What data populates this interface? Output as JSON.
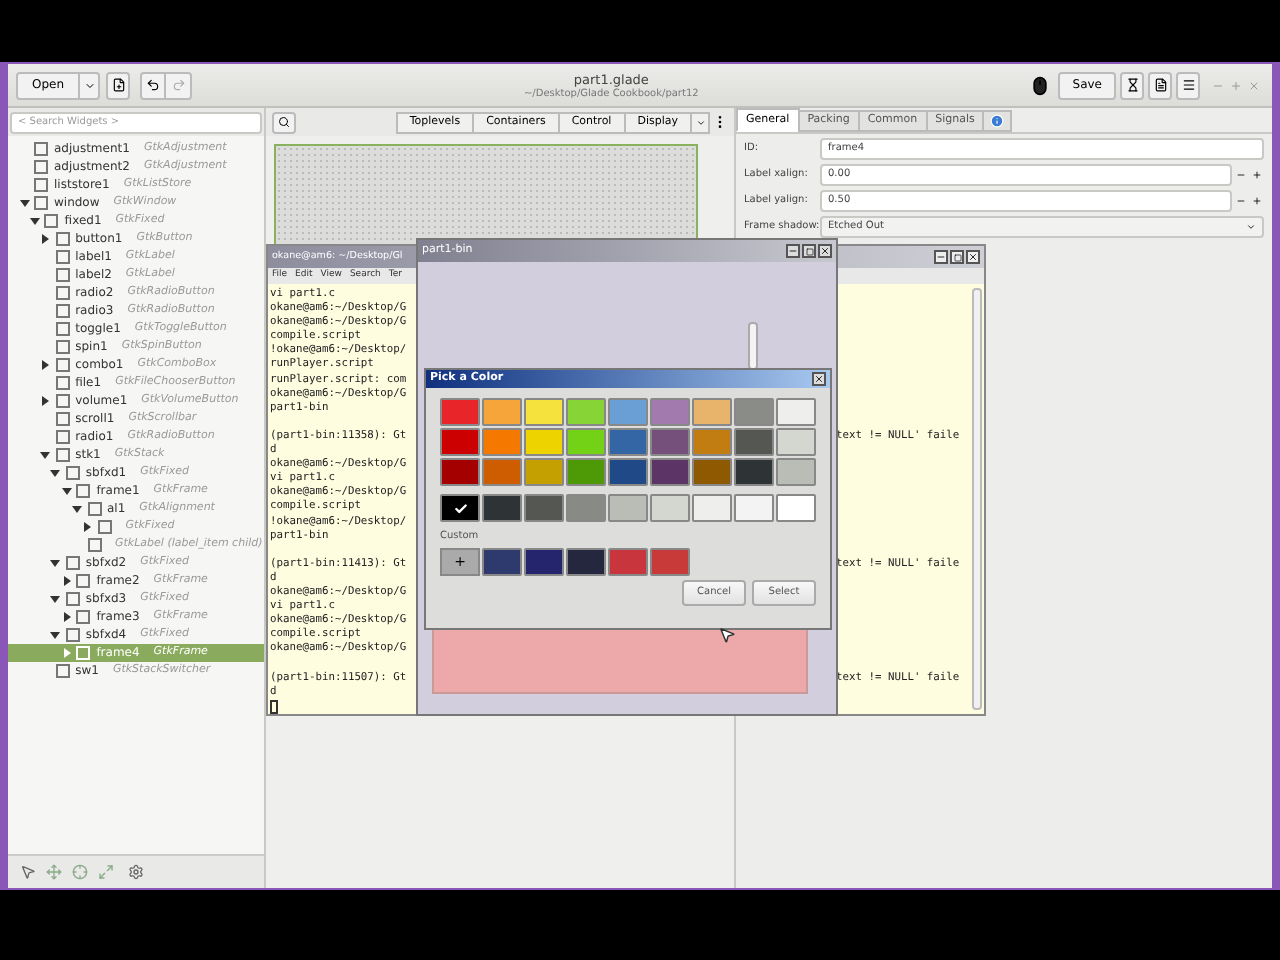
{
  "header": {
    "open_button": "Open",
    "title": "part1.glade",
    "subtitle": "~/Desktop/Glade Cookbook/part12",
    "save_button": "Save"
  },
  "search": {
    "placeholder": "< Search Widgets >"
  },
  "palette_tabs": [
    "Toplevels",
    "Containers",
    "Control",
    "Display"
  ],
  "tree": [
    {
      "name": "adjustment1",
      "type": "GtkAdjustment",
      "selected": false
    },
    {
      "name": "adjustment2",
      "type": "GtkAdjustment",
      "selected": false
    },
    {
      "name": "liststore1",
      "type": "GtkListStore",
      "selected": false
    },
    {
      "name": "window",
      "type": "GtkWindow",
      "selected": false,
      "expanded": true,
      "children": [
        {
          "name": "fixed1",
          "type": "GtkFixed",
          "selected": false,
          "expanded": true,
          "children": [
            {
              "name": "button1",
              "type": "GtkButton",
              "selected": false,
              "expanded": false
            },
            {
              "name": "label1",
              "type": "GtkLabel",
              "selected": false
            },
            {
              "name": "label2",
              "type": "GtkLabel",
              "selected": false
            },
            {
              "name": "radio2",
              "type": "GtkRadioButton",
              "selected": false
            },
            {
              "name": "radio3",
              "type": "GtkRadioButton",
              "selected": false
            },
            {
              "name": "toggle1",
              "type": "GtkToggleButton",
              "selected": false
            },
            {
              "name": "spin1",
              "type": "GtkSpinButton",
              "selected": false
            },
            {
              "name": "combo1",
              "type": "GtkComboBox",
              "selected": false,
              "expanded": false
            },
            {
              "name": "file1",
              "type": "GtkFileChooserButton",
              "selected": false
            },
            {
              "name": "volume1",
              "type": "GtkVolumeButton",
              "selected": false,
              "expanded": false
            },
            {
              "name": "scroll1",
              "type": "GtkScrollbar",
              "selected": false
            },
            {
              "name": "radio1",
              "type": "GtkRadioButton",
              "selected": false
            },
            {
              "name": "stk1",
              "type": "GtkStack",
              "selected": false,
              "expanded": true,
              "children": [
                {
                  "name": "sbfxd1",
                  "type": "GtkFixed",
                  "selected": false,
                  "expanded": true,
                  "children": [
                    {
                      "name": "frame1",
                      "type": "GtkFrame",
                      "selected": false,
                      "expanded": true,
                      "children": [
                        {
                          "name": "al1",
                          "type": "GtkAlignment",
                          "selected": false,
                          "expanded": true,
                          "children": [
                            {
                              "type": "GtkFixed",
                              "selected": false,
                              "expanded": false
                            }
                          ]
                        },
                        {
                          "type": "GtkLabel (label_item child)",
                          "selected": false
                        }
                      ]
                    }
                  ]
                },
                {
                  "name": "sbfxd2",
                  "type": "GtkFixed",
                  "selected": false,
                  "expanded": true,
                  "children": [
                    {
                      "name": "frame2",
                      "type": "GtkFrame",
                      "selected": false,
                      "expanded": false
                    }
                  ]
                },
                {
                  "name": "sbfxd3",
                  "type": "GtkFixed",
                  "selected": false,
                  "expanded": true,
                  "children": [
                    {
                      "name": "frame3",
                      "type": "GtkFrame",
                      "selected": false,
                      "expanded": false
                    }
                  ]
                },
                {
                  "name": "sbfxd4",
                  "type": "GtkFixed",
                  "selected": false,
                  "expanded": true,
                  "children": [
                    {
                      "name": "frame4",
                      "type": "GtkFrame",
                      "selected": true,
                      "expanded": false
                    }
                  ]
                }
              ]
            },
            {
              "name": "sw1",
              "type": "GtkStackSwitcher",
              "selected": false
            }
          ]
        }
      ]
    }
  ],
  "property_tabs": [
    {
      "label": "General",
      "selected": true
    },
    {
      "label": "Packing",
      "selected": false
    },
    {
      "label": "Common",
      "selected": false
    },
    {
      "label": "Signals",
      "selected": false
    }
  ],
  "properties": [
    {
      "label": "ID:",
      "value": "frame4",
      "kind": "text"
    },
    {
      "label": "Label xalign:",
      "value": "0.00",
      "kind": "spin"
    },
    {
      "label": "Label yalign:",
      "value": "0.50",
      "kind": "spin"
    },
    {
      "label": "Frame shadow:",
      "value": "Etched Out",
      "kind": "combo"
    }
  ],
  "terminal": {
    "title": "okane@am6: ~/Desktop/Gl",
    "menu": [
      "File",
      "Edit",
      "View",
      "Search",
      "Ter"
    ],
    "lines": [
      {
        "text": "vi part1.c"
      },
      {
        "text": "okane@am6:~/Desktop/G"
      },
      {
        "text": "okane@am6:~/Desktop/G"
      },
      {
        "text": "compile.script"
      },
      {
        "text": "!okane@am6:~/Desktop/"
      },
      {
        "text": "runPlayer.script"
      },
      {
        "text": "runPlayer.script: com"
      },
      {
        "text": "okane@am6:~/Desktop/G"
      },
      {
        "text": "part1-bin"
      },
      {
        "text": "(part1-bin:11358): Gt",
        "tail": "text != NULL' faile",
        "blank_before": true
      },
      {
        "text": "d"
      },
      {
        "text": "okane@am6:~/Desktop/G"
      },
      {
        "text": "vi part1.c"
      },
      {
        "text": "okane@am6:~/Desktop/G"
      },
      {
        "text": "compile.script"
      },
      {
        "text": "!okane@am6:~/Desktop/"
      },
      {
        "text": "part1-bin"
      },
      {
        "text": "(part1-bin:11413): Gt",
        "tail": "text != NULL' faile",
        "blank_before": true
      },
      {
        "text": "d"
      },
      {
        "text": "okane@am6:~/Desktop/G"
      },
      {
        "text": "vi part1.c"
      },
      {
        "text": "okane@am6:~/Desktop/G"
      },
      {
        "text": "compile.script"
      },
      {
        "text": "okane@am6:~/Desktop/G"
      },
      {
        "text": "(part1-bin:11507): Gt",
        "tail": "text != NULL' faile",
        "blank_before": true
      },
      {
        "text": "d"
      }
    ]
  },
  "app_window": {
    "title": "part1-bin"
  },
  "color_dialog": {
    "title": "Pick a Color",
    "palette": [
      {
        "color": "#e8262a",
        "selected": false
      },
      {
        "color": "#f5a53a",
        "selected": false
      },
      {
        "color": "#f5e23c",
        "selected": false
      },
      {
        "color": "#86d435",
        "selected": false
      },
      {
        "color": "#6a9fd6",
        "selected": false
      },
      {
        "color": "#a37aad",
        "selected": false
      },
      {
        "color": "#e8b36a",
        "selected": false
      },
      {
        "color": "#8a8c87",
        "selected": false
      },
      {
        "color": "#eeeeec",
        "selected": false
      },
      {
        "color": "#cc0000",
        "selected": false
      },
      {
        "color": "#f57900",
        "selected": false
      },
      {
        "color": "#edd400",
        "selected": false
      },
      {
        "color": "#73d216",
        "selected": false
      },
      {
        "color": "#3465a4",
        "selected": false
      },
      {
        "color": "#75507b",
        "selected": false
      },
      {
        "color": "#c17d11",
        "selected": false
      },
      {
        "color": "#555753",
        "selected": false
      },
      {
        "color": "#d3d7cf",
        "selected": false
      },
      {
        "color": "#a40000",
        "selected": false
      },
      {
        "color": "#ce5c00",
        "selected": false
      },
      {
        "color": "#c4a000",
        "selected": false
      },
      {
        "color": "#4e9a06",
        "selected": false
      },
      {
        "color": "#204a87",
        "selected": false
      },
      {
        "color": "#5c3566",
        "selected": false
      },
      {
        "color": "#8f5902",
        "selected": false
      },
      {
        "color": "#2e3436",
        "selected": false
      },
      {
        "color": "#babdb6",
        "selected": false
      }
    ],
    "grays": [
      {
        "color": "#000000",
        "selected": true
      },
      {
        "color": "#2e3436",
        "selected": false
      },
      {
        "color": "#555753",
        "selected": false
      },
      {
        "color": "#888a85",
        "selected": false
      },
      {
        "color": "#babdb6",
        "selected": false
      },
      {
        "color": "#d3d7cf",
        "selected": false
      },
      {
        "color": "#eeeeec",
        "selected": false
      },
      {
        "color": "#f3f3f3",
        "selected": false
      },
      {
        "color": "#ffffff",
        "selected": false
      }
    ],
    "custom_label": "Custom",
    "add_button": "+",
    "custom": [
      {
        "color": "#2e3a6e"
      },
      {
        "color": "#25256e"
      },
      {
        "color": "#25273f"
      },
      {
        "color": "#c8353c"
      },
      {
        "color": "#c83a3a"
      }
    ],
    "buttons": [
      "Cancel",
      "Select"
    ]
  }
}
